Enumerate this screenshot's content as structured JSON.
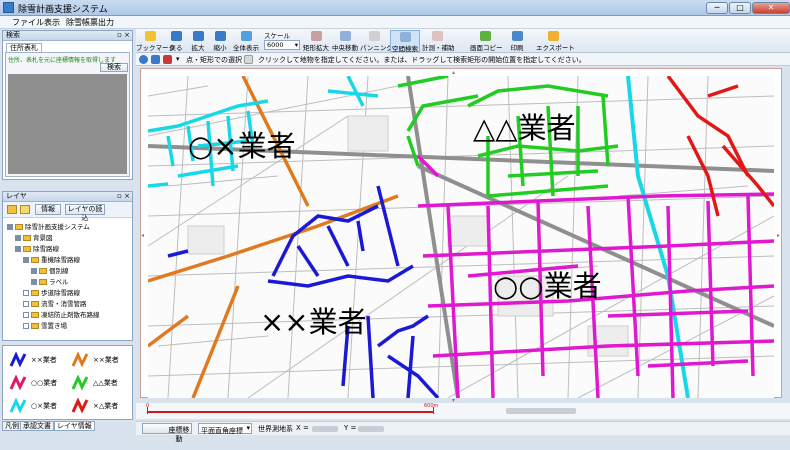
{
  "window": {
    "title": "除雪計画支援システム",
    "buttons": [
      "─",
      "□",
      "✕"
    ]
  },
  "menu": [
    "ファイル",
    "表示",
    "除雪帳票出力"
  ],
  "search_panel": {
    "title": "検索",
    "tab": "住所表札",
    "note": "住所、表札を元に座標情報を取得します",
    "search_button": "検索"
  },
  "layer_panel": {
    "title": "レイヤ",
    "toolbar": {
      "info_label": "情報",
      "read_label": "レイヤの読込"
    },
    "tree": [
      {
        "label": "除雪計画支援システム",
        "level": 0,
        "checked": true
      },
      {
        "label": "背景図",
        "level": 1,
        "checked": true
      },
      {
        "label": "除雪路線",
        "level": 1,
        "checked": true
      },
      {
        "label": "重機除雪路線",
        "level": 2,
        "checked": true
      },
      {
        "label": "個別線",
        "level": 3,
        "checked": true
      },
      {
        "label": "ラベル",
        "level": 3,
        "checked": true
      },
      {
        "label": "歩道除雪路線",
        "level": 2,
        "checked": false
      },
      {
        "label": "流雪・消雪管路",
        "level": 2,
        "checked": false
      },
      {
        "label": "凍結防止剤散布路線",
        "level": 2,
        "checked": false
      },
      {
        "label": "雪置き場",
        "level": 2,
        "checked": false
      }
    ]
  },
  "legend": [
    {
      "label": "××業者",
      "color": "#1a1ad6"
    },
    {
      "label": "××業者",
      "color": "#e07a20"
    },
    {
      "label": "○○業者",
      "color": "#e0186c"
    },
    {
      "label": "△△業者",
      "color": "#22cc22"
    },
    {
      "label": "○×業者",
      "color": "#18d8e8"
    },
    {
      "label": "×△業者",
      "color": "#e01818"
    }
  ],
  "bottom_tabs": [
    "凡例",
    "承認文書",
    "レイヤ情報"
  ],
  "toolbar": [
    {
      "label": "ブックマーク",
      "icon": "star-icon",
      "color": "#f2c230"
    },
    {
      "label": "戻る",
      "icon": "back-icon",
      "color": "#3a78c8"
    },
    {
      "label": "拡大",
      "icon": "zoom-in-icon",
      "color": "#3a78c8"
    },
    {
      "label": "縮小",
      "icon": "zoom-out-icon",
      "color": "#3a78c8"
    },
    {
      "label": "全体表示",
      "icon": "full-extent-icon",
      "color": "#4fa0e0"
    },
    {
      "label": "矩形拡大",
      "icon": "rect-zoom-icon",
      "color": "#c8a0a0"
    },
    {
      "label": "中央移動",
      "icon": "center-move-icon",
      "color": "#8fb0d8"
    },
    {
      "label": "パンニング",
      "icon": "pan-icon",
      "color": "#d0d0d0"
    },
    {
      "label": "空間検索",
      "icon": "spatial-search-icon",
      "color": "#8fb0d8"
    },
    {
      "label": "計測・補助",
      "icon": "measure-icon",
      "color": "#e0c0c0"
    },
    {
      "label": "画面コピー",
      "icon": "screen-copy-icon",
      "color": "#60b040"
    },
    {
      "label": "印刷",
      "icon": "print-icon",
      "color": "#4a88c8"
    },
    {
      "label": "エクスポート",
      "icon": "export-icon",
      "color": "#f0b030"
    }
  ],
  "scale": {
    "label": "スケール",
    "value": "6000"
  },
  "hint_bar": {
    "mode": "点・矩形での選択",
    "message": "クリックして地物を指定してください。または、ドラッグして検索矩形の開始位置を指定してください。"
  },
  "map_labels": [
    {
      "text": "○×業者",
      "color": "#18d8e8"
    },
    {
      "text": "△△業者",
      "color": "#22cc22"
    },
    {
      "text": "○○業者",
      "color": "#e0186c"
    },
    {
      "text": "××業者",
      "color": "#1a1ad6"
    }
  ],
  "scalebar": {
    "start": "0",
    "end": "600m"
  },
  "status": {
    "coord_move_button": "座標移動",
    "coord_system": "平面直角座標",
    "world_label": "世界測地系",
    "x_label": "X =",
    "y_label": "Y ="
  }
}
